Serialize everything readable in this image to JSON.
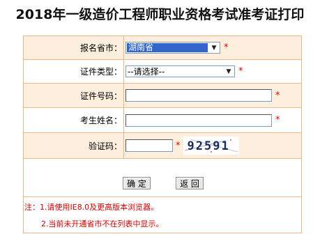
{
  "page": {
    "title": "2018年一级造价工程师职业资格考试准考证打印"
  },
  "form": {
    "province": {
      "label": "报名省市：",
      "value": "湖南省",
      "required_mark": "*"
    },
    "id_type": {
      "label": "证件类型：",
      "value": "--请选择--",
      "required_mark": "*"
    },
    "id_number": {
      "label": "证件号码：",
      "value": "",
      "required_mark": "*"
    },
    "name": {
      "label": "考生姓名：",
      "value": "",
      "required_mark": "*"
    },
    "captcha": {
      "label": "验证码：",
      "value": "",
      "required_mark": "*",
      "image_text": "92591"
    }
  },
  "buttons": {
    "confirm": "确 定",
    "back": "返 回"
  },
  "notes": {
    "line1": "注：1.请使用IE8.0及更高版本浏览器。",
    "line2": "2.当前未开通省市不在列表中显示。"
  },
  "colors": {
    "border": "#e8b88a",
    "row_tint": "#fdeedd",
    "required": "#e00000",
    "note": "#cc0000",
    "selected": "#3366cc"
  }
}
